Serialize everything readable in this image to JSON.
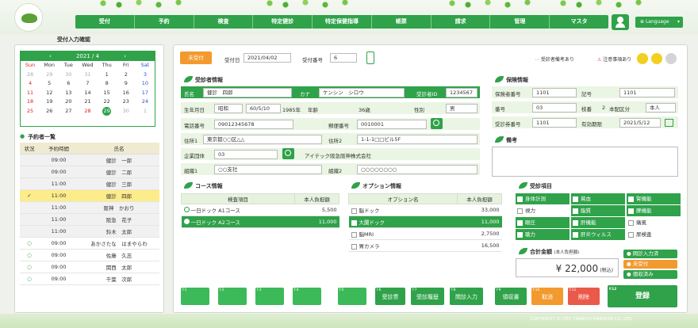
{
  "nav": [
    "受付",
    "予約",
    "検査",
    "特定健診",
    "特定保健指導",
    "帳票",
    "請求",
    "管理",
    "マスタ"
  ],
  "language": "Language",
  "page_title": "受付入力確認",
  "calendar": {
    "month": "2021 / 4",
    "prev": "‹",
    "next": "›",
    "weekdays": [
      "Sun",
      "Mon",
      "Tue",
      "Wed",
      "Thu",
      "Fri",
      "Sat"
    ],
    "days": [
      "28",
      "29",
      "30",
      "31",
      "1",
      "2",
      "3",
      "4",
      "5",
      "6",
      "7",
      "8",
      "9",
      "10",
      "11",
      "12",
      "13",
      "14",
      "15",
      "16",
      "17",
      "18",
      "19",
      "20",
      "21",
      "22",
      "23",
      "24",
      "25",
      "26",
      "27",
      "28",
      "29",
      "30",
      "1"
    ]
  },
  "reservations": {
    "title": "予約者一覧",
    "headers": [
      "状況",
      "予約時間",
      "氏名"
    ],
    "rows": [
      [
        "",
        "09:00",
        "健診　一郎"
      ],
      [
        "",
        "09:00",
        "健診　二郎"
      ],
      [
        "",
        "11:00",
        "健診　三郎"
      ],
      [
        "✓",
        "11:00",
        "健診　四郎"
      ],
      [
        "",
        "11:00",
        "阪神　かおり"
      ],
      [
        "",
        "11:00",
        "阪急　花子"
      ],
      [
        "",
        "11:00",
        "鈴木　太郎"
      ],
      [
        "○",
        "09:00",
        "あかさたな　はまやらわ"
      ],
      [
        "○",
        "09:00",
        "佐藤　久志"
      ],
      [
        "○",
        "09:00",
        "関西　太郎"
      ],
      [
        "○",
        "09:00",
        "千葉　次郎"
      ]
    ]
  },
  "status": {
    "badge": "未受付",
    "date_label": "受付日",
    "date": "2021/04/02",
    "no_label": "受付番号",
    "no": "6",
    "note1": "受診者備考あり",
    "note2": "注意事項あり"
  },
  "patient": {
    "title": "受診者情報",
    "name_label": "氏名",
    "name": "健診　四郎",
    "kana_label": "カナ",
    "kana": "ケンシン　シロウ",
    "id_label": "受診者ID",
    "id": "1234567",
    "dob_label": "生年月日",
    "era": "昭和",
    "dob": "60/5/10",
    "year": "1985年",
    "age_label": "年齢",
    "age": "36歳",
    "sex_label": "性別",
    "sex": "男",
    "tel_label": "電話番号",
    "tel": "09012345678",
    "zip_label": "郵便番号",
    "zip": "0010001",
    "addr1_label": "住所1",
    "addr1": "東京都○○区△△",
    "addr2_label": "住所2",
    "addr2": "1-1-1□□ビル5F",
    "company_label": "企業団体",
    "company": "03",
    "company_name": "アイテック阪急阪神株式会社",
    "org1_label": "組織1",
    "org1": "○○支社",
    "org2_label": "組織2",
    "org2": "○○○○○○○○"
  },
  "insurance": {
    "title": "保険情報",
    "holder_label": "保険者番号",
    "holder": "1101",
    "mark_label": "記号",
    "mark": "1101",
    "num_label": "番号",
    "num": "03",
    "branch_label": "枝番",
    "branch": "2",
    "rel_label": "本配区分",
    "rel": "本人",
    "card_label": "受診券番号",
    "card": "1101",
    "exp_label": "有効期限",
    "exp": "2021/5/12"
  },
  "memo": {
    "title": "備考"
  },
  "course": {
    "title": "コース情報",
    "headers": [
      "検査項目",
      "本人負担額"
    ],
    "rows": [
      [
        "一日ドック A1コース",
        "5,500"
      ],
      [
        "一日ドック A2コース",
        "11,000"
      ]
    ]
  },
  "option": {
    "title": "オプション情報",
    "headers": [
      "オプション名",
      "本人負担額"
    ],
    "rows": [
      [
        "脳ドック",
        "33,000"
      ],
      [
        "大腸ドック",
        "11,000"
      ],
      [
        "脳MRI",
        "2,7500"
      ],
      [
        "胃カメラ",
        "16,500"
      ]
    ]
  },
  "exams": {
    "title": "受診項目",
    "items": [
      "身体計測",
      "貧血",
      "腎機能",
      "視力",
      "脂質",
      "脾機能",
      "眼圧",
      "肝機能",
      "痛風",
      "聴力",
      "肝炎ウィルス",
      "尿検査"
    ]
  },
  "total": {
    "title": "合計金額",
    "sub": "(本人負担額)",
    "amount": "¥ 22,000",
    "tax": "(税込)",
    "s1": "問診入力済",
    "s2": "未受付",
    "s3": "個収済み"
  },
  "fkeys": [
    "F1",
    "F2",
    "F3",
    "F4",
    "F5",
    "F6",
    "F7",
    "F8",
    "F9",
    "F10",
    "F11",
    "F12"
  ],
  "buttons": {
    "f6": "受診票",
    "f7": "受診履歴",
    "f8": "問診入力",
    "f9": "領収書",
    "f10": "取消",
    "f11": "削除",
    "f12": "登録"
  },
  "copyright": "COPYRIGHT © ITEC HANKYU HANSHIN CO.,LTD."
}
